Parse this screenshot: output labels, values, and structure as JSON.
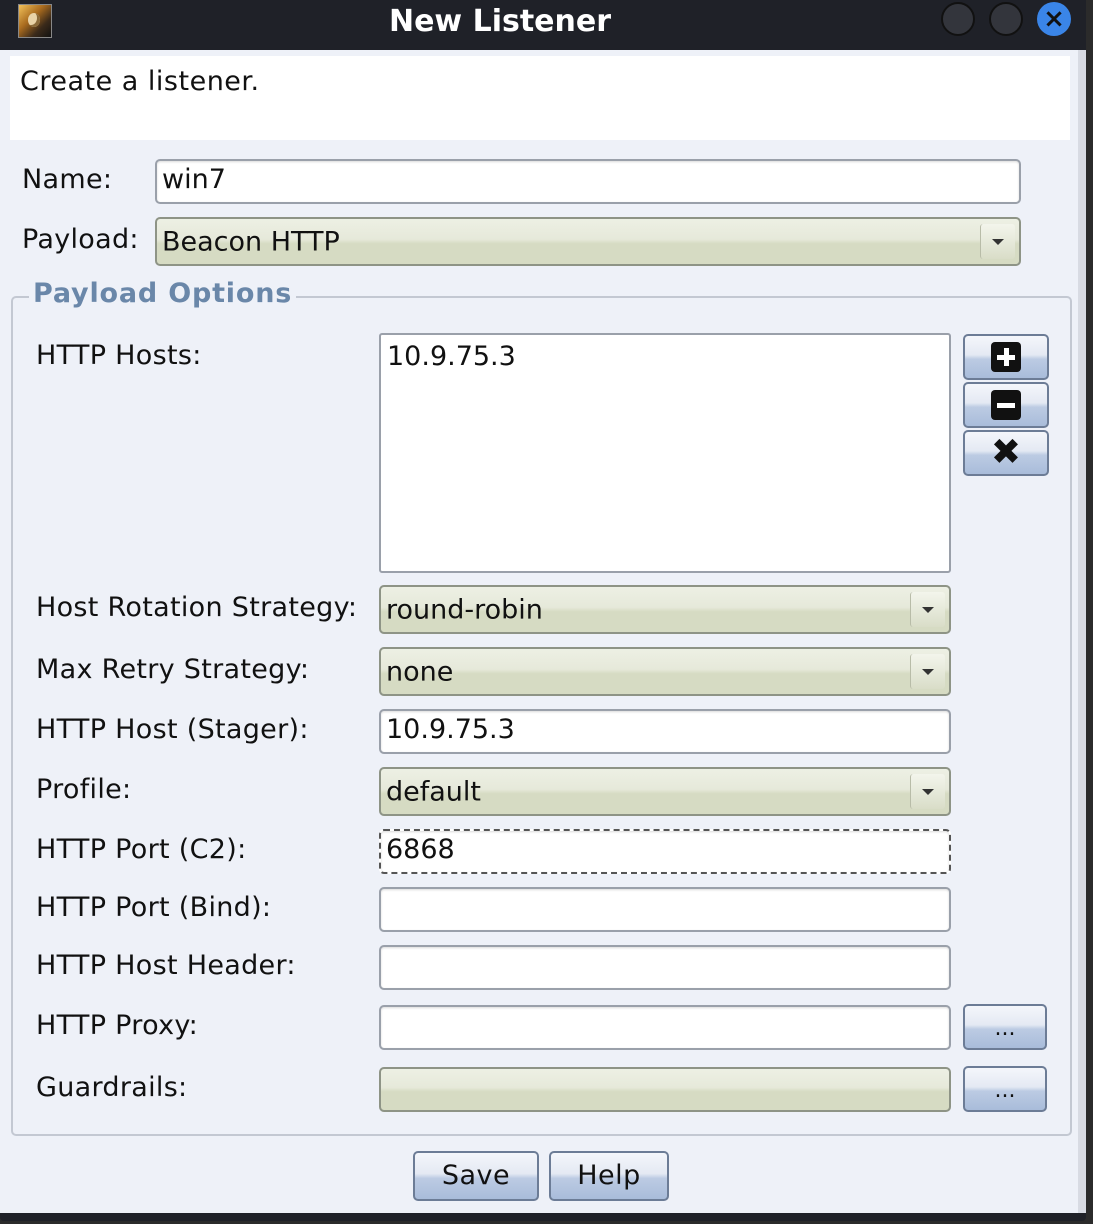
{
  "window": {
    "title": "New Listener",
    "app_icon": "cobalt-strike-app-icon",
    "controls": {
      "minimize": "minimize-icon",
      "maximize": "maximize-icon",
      "close": "×"
    }
  },
  "description": "Create a listener.",
  "form": {
    "name_label": "Name:",
    "name_value": "win7",
    "payload_label": "Payload:",
    "payload_value": "Beacon HTTP"
  },
  "payload_options": {
    "title": "Payload Options",
    "http_hosts_label": "HTTP Hosts:",
    "http_hosts": [
      "10.9.75.3"
    ],
    "host_buttons": {
      "add": "plus-icon",
      "remove": "minus-icon",
      "clear": "✖"
    },
    "rotation_label": "Host Rotation Strategy:",
    "rotation_value": "round-robin",
    "retry_label": "Max Retry Strategy:",
    "retry_value": "none",
    "stager_label": "HTTP Host (Stager):",
    "stager_value": "10.9.75.3",
    "profile_label": "Profile:",
    "profile_value": "default",
    "port_c2_label": "HTTP Port (C2):",
    "port_c2_value": "6868",
    "port_bind_label": "HTTP Port (Bind):",
    "port_bind_value": "",
    "host_header_label": "HTTP Host Header:",
    "host_header_value": "",
    "proxy_label": "HTTP Proxy:",
    "proxy_value": "",
    "proxy_button": "...",
    "guardrails_label": "Guardrails:",
    "guardrails_value": "",
    "guardrails_button": "..."
  },
  "actions": {
    "save": "Save",
    "help": "Help"
  },
  "colors": {
    "titlebar": "#1f2128",
    "client": "#eef1f8",
    "group_title": "#6a87a9",
    "close_button": "#3a85e8"
  }
}
